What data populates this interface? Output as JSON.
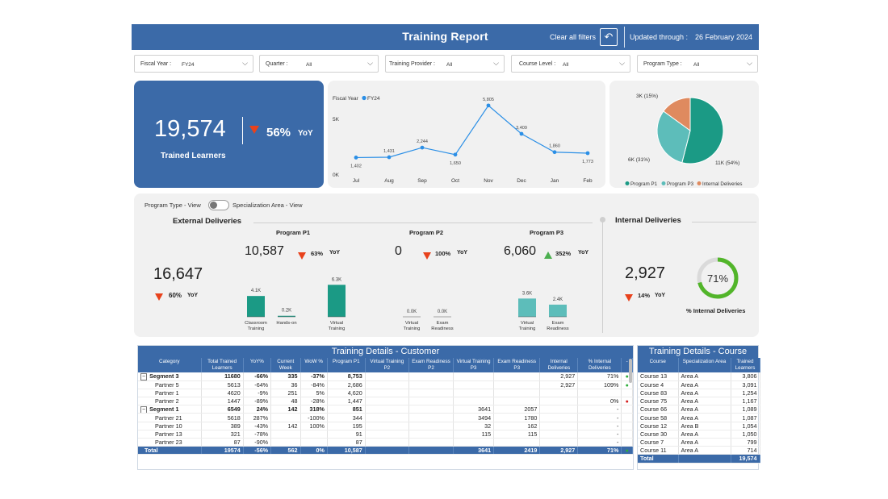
{
  "header": {
    "title": "Training Report",
    "clear_filters": "Clear all filters",
    "undo_icon": "↶",
    "updated_label": "Updated through :",
    "updated_date": "26 February 2024"
  },
  "filters": [
    {
      "label": "Fiscal Year :",
      "value": "FY24"
    },
    {
      "label": "Quarter :",
      "value": "All"
    },
    {
      "label": "Training Provider :",
      "value": "All"
    },
    {
      "label": "Course Level :",
      "value": "All"
    },
    {
      "label": "Program Type :",
      "value": "All"
    }
  ],
  "kpi": {
    "value": "19,574",
    "label": "Trained Learners",
    "pct": "56%",
    "yoy": "YoY"
  },
  "line_chart": {
    "legend_title": "Fiscal Year",
    "legend_series": "FY24",
    "color": "#2b8fe6",
    "y_ticks": [
      "5K",
      "0K"
    ],
    "months": [
      "Jul",
      "Aug",
      "Sep",
      "Oct",
      "Nov",
      "Dec",
      "Jan",
      "Feb"
    ],
    "values": [
      1402,
      1431,
      2244,
      1650,
      5805,
      3409,
      1860,
      1773
    ],
    "labels": [
      "1,402",
      "1,431",
      "2,244",
      "1,650",
      "5,805",
      "3,409",
      "1,860",
      "1,773"
    ],
    "ymax": 6000
  },
  "pie": {
    "slices": [
      {
        "name": "Program P1",
        "value": 54,
        "label": "11K (54%)",
        "color": "#1b9a85"
      },
      {
        "name": "Program P3",
        "value": 31,
        "label": "6K (31%)",
        "color": "#5dbdba"
      },
      {
        "name": "Internal Deliveries",
        "value": 15,
        "label": "3K (15%)",
        "color": "#df8a5f"
      }
    ]
  },
  "toggle": {
    "left": "Program Type - View",
    "right": "Specialization Area - View"
  },
  "external": {
    "title": "External Deliveries",
    "value": "16,647",
    "pct": "60%",
    "yoy": "YoY",
    "programs": [
      {
        "name": "Program P1",
        "value": "10,587",
        "pct": "63%",
        "yoy": "YoY",
        "trend": "down",
        "bars": [
          {
            "label": "4.1K",
            "value": 4.1,
            "cat": "Classroom Training",
            "color": "#1b9a85"
          },
          {
            "label": "0.2K",
            "value": 0.2,
            "cat": "Hands-on",
            "color": "#1b9a85"
          },
          {
            "label": "6.3K",
            "value": 6.3,
            "cat": "Virtual Training",
            "color": "#1b9a85"
          }
        ]
      },
      {
        "name": "Program P2",
        "value": "0",
        "pct": "100%",
        "yoy": "YoY",
        "trend": "down",
        "bars": [
          {
            "label": "0.0K",
            "value": 0,
            "cat": "Virtual Training",
            "color": "#1b9a85"
          },
          {
            "label": "0.0K",
            "value": 0,
            "cat": "Exam Readiness",
            "color": "#1b9a85"
          }
        ]
      },
      {
        "name": "Program P3",
        "value": "6,060",
        "pct": "352%",
        "yoy": "YoY",
        "trend": "up",
        "bars": [
          {
            "label": "3.6K",
            "value": 3.6,
            "cat": "Virtual Training",
            "color": "#5dbdba"
          },
          {
            "label": "2.4K",
            "value": 2.4,
            "cat": "Exam Readiness",
            "color": "#5dbdba"
          }
        ]
      }
    ]
  },
  "internal": {
    "title": "Internal Deliveries",
    "value": "2,927",
    "pct": "14%",
    "yoy": "YoY",
    "gauge_pct": 71,
    "gauge_label": "71%",
    "gauge_caption": "% Internal Deliveries",
    "gauge_color": "#52b52a"
  },
  "customer_table": {
    "title": "Training Details - Customer",
    "headers": [
      "Category",
      "Total Trained Learners",
      "YoY%",
      "Current Week",
      "WoW %",
      "Program P1",
      "Virtual Training P2",
      "Exam Readiness P2",
      "Virtual Training P3",
      "Exam Readiness P3",
      "Internal Deliveries",
      "% Internal Deliveries",
      "-"
    ],
    "rows": [
      {
        "level": 0,
        "cells": [
          "Segment 3",
          "11680",
          "-66%",
          "335",
          "-37%",
          "8,753",
          "",
          "",
          "",
          "",
          "2,927",
          "71%",
          "g"
        ]
      },
      {
        "level": 1,
        "cells": [
          "Partner 5",
          "5613",
          "-64%",
          "36",
          "-84%",
          "2,686",
          "",
          "",
          "",
          "",
          "2,927",
          "109%",
          "g"
        ]
      },
      {
        "level": 1,
        "cells": [
          "Partner 1",
          "4620",
          "-9%",
          "251",
          "5%",
          "4,620",
          "",
          "",
          "",
          "",
          "",
          "",
          ""
        ]
      },
      {
        "level": 1,
        "cells": [
          "Partner 2",
          "1447",
          "-89%",
          "48",
          "-28%",
          "1,447",
          "",
          "",
          "",
          "",
          "",
          "0%",
          "r"
        ]
      },
      {
        "level": 0,
        "cells": [
          "Segment 1",
          "6549",
          "24%",
          "142",
          "318%",
          "851",
          "",
          "",
          "3641",
          "2057",
          "",
          "-",
          ""
        ]
      },
      {
        "level": 1,
        "cells": [
          "Partner 21",
          "5618",
          "287%",
          "",
          "-100%",
          "344",
          "",
          "",
          "3494",
          "1780",
          "",
          "-",
          ""
        ]
      },
      {
        "level": 1,
        "cells": [
          "Partner 10",
          "389",
          "-43%",
          "142",
          "100%",
          "195",
          "",
          "",
          "32",
          "162",
          "",
          "-",
          ""
        ]
      },
      {
        "level": 1,
        "cells": [
          "Partner 13",
          "321",
          "-78%",
          "",
          "",
          "91",
          "",
          "",
          "115",
          "115",
          "",
          "-",
          ""
        ]
      },
      {
        "level": 1,
        "cells": [
          "Partner 23",
          "87",
          "-90%",
          "",
          "",
          "87",
          "",
          "",
          "",
          "",
          "",
          "-",
          ""
        ]
      }
    ],
    "total": [
      "Total",
      "19574",
      "-56%",
      "562",
      "0%",
      "10,587",
      "",
      "",
      "3641",
      "2419",
      "2,927",
      "71%",
      "g"
    ]
  },
  "course_table": {
    "title": "Training Details - Course",
    "headers": [
      "Course",
      "Specialization Area",
      "Trained Learners"
    ],
    "rows": [
      [
        "Course 13",
        "Area A",
        "3,806"
      ],
      [
        "Course 4",
        "Area A",
        "3,091"
      ],
      [
        "Course 83",
        "Area A",
        "1,254"
      ],
      [
        "Course 75",
        "Area A",
        "1,167"
      ],
      [
        "Course 66",
        "Area A",
        "1,089"
      ],
      [
        "Course 58",
        "Area A",
        "1,087"
      ],
      [
        "Course 12",
        "Area B",
        "1,054"
      ],
      [
        "Course 30",
        "Area A",
        "1,050"
      ],
      [
        "Course 7",
        "Area A",
        "799"
      ],
      [
        "Course 11",
        "Area A",
        "714"
      ]
    ],
    "total": [
      "Total",
      "",
      "19,574"
    ]
  }
}
